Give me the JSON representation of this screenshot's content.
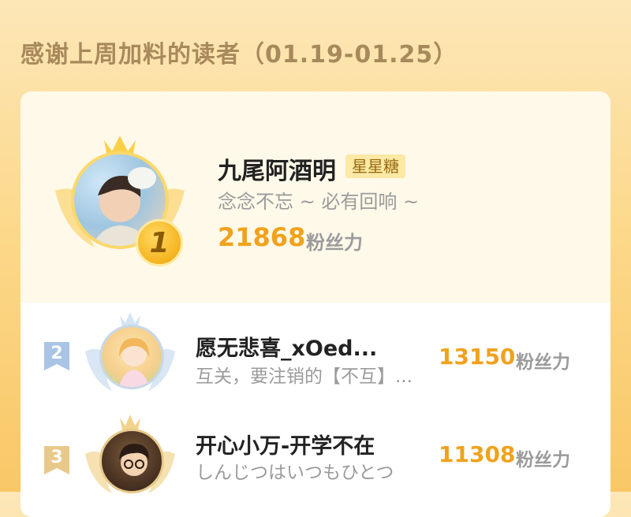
{
  "header": {
    "title": "感谢上周加料的读者（01.19-01.25）"
  },
  "top_reader": {
    "rank": "1",
    "name": "九尾阿酒明",
    "tag": "星星糖",
    "motto": "念念不忘 ~ 必有回响 ~",
    "score": "21868",
    "score_unit": "粉丝力"
  },
  "readers": [
    {
      "rank": "2",
      "name": "愿无悲喜_xOed...",
      "motto": "互关，要注销的【不互】...",
      "score": "13150",
      "score_unit": "粉丝力"
    },
    {
      "rank": "3",
      "name": "开心小万-开学不在",
      "motto": "しんじつはいつもひとつ",
      "score": "11308",
      "score_unit": "粉丝力"
    }
  ],
  "colors": {
    "accent": "#f0a21d",
    "gold_badge": "#f5b41f",
    "rank2_flag": "#a9c4e4",
    "rank3_flag": "#e8c98a"
  }
}
